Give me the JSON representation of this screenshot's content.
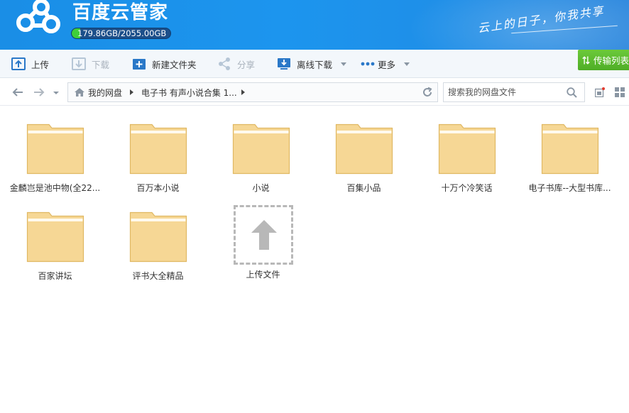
{
  "app": {
    "title": "百度云管家",
    "slogan": "云上的日子，你我共享",
    "quota_text": "179.86GB/2055.00GB",
    "quota_fraction": 0.0875
  },
  "toolbar": {
    "upload": "上传",
    "download": "下载",
    "new_folder": "新建文件夹",
    "share": "分享",
    "offline_download": "离线下载",
    "more": "更多",
    "transfer_list": "传输列表"
  },
  "address": {
    "crumbs": [
      "我的网盘",
      "电子书 有声小说合集 1..."
    ],
    "search_placeholder": "搜索我的网盘文件"
  },
  "files": [
    {
      "name": "金麟岂是池中物(全22..."
    },
    {
      "name": "百万本小说"
    },
    {
      "name": "小说"
    },
    {
      "name": "百集小品"
    },
    {
      "name": "十万个冷笑话"
    },
    {
      "name": "电子书库--大型书库..."
    },
    {
      "name": "百家讲坛"
    },
    {
      "name": "评书大全精品"
    }
  ],
  "upload_tile": {
    "label": "上传文件"
  },
  "colors": {
    "header_blue": "#1c95ee",
    "folder_fill": "#f6d795",
    "folder_stroke": "#e0b863",
    "quota_green": "#3fcf3a",
    "transfer_green": "#5bbd2e"
  }
}
